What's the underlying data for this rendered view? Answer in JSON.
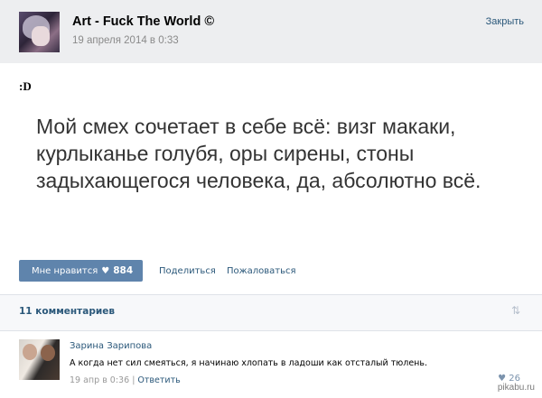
{
  "header": {
    "author": "Art - Fuck The World ©",
    "date": "19 апреля 2014 в 0:33",
    "close_label": "Закрыть"
  },
  "post": {
    "smile": ":D",
    "text": "Мой смех сочетает в себе всё: визг макаки, курлыканье голубя, оры сирены, стоны задыхающегося человека, да, абсолютно всё."
  },
  "actions": {
    "like_label": "Мне нравится",
    "like_icon": "heart-icon",
    "like_count": "884",
    "share_label": "Поделиться",
    "report_label": "Пожаловаться"
  },
  "comments": {
    "count_label": "11 комментариев",
    "sort_icon": "sort-arrows-icon",
    "items": [
      {
        "name": "Зарина Зарипова",
        "text": "А когда нет сил смеяться, я начинаю хлопать в ладоши как отсталый тюлень.",
        "time": "19 апр в 0:36",
        "separator": "|",
        "reply_label": "Ответить",
        "likes": "26"
      }
    ]
  },
  "watermark": "pikabu.ru",
  "colors": {
    "link": "#2b587a",
    "like_button": "#5f84ac",
    "header_bg": "#edeef0"
  }
}
